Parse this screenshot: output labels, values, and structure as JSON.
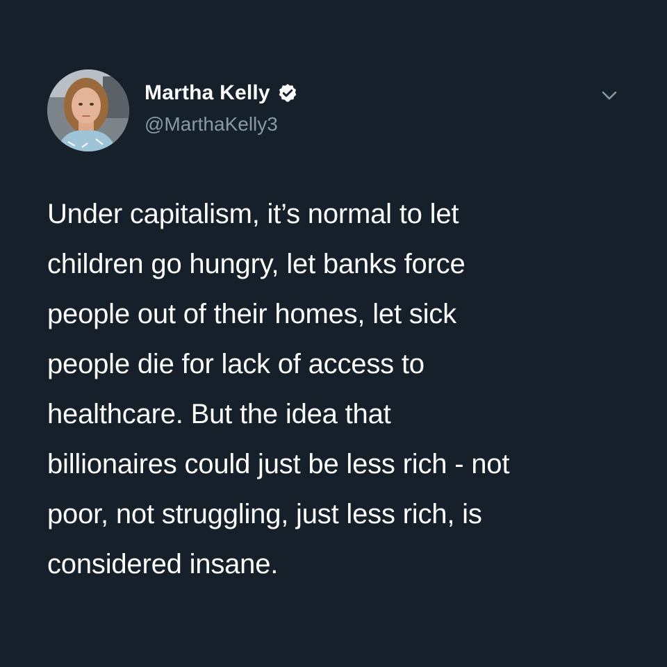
{
  "tweet": {
    "author": {
      "display_name": "Martha Kelly",
      "handle": "@MarthaKelly3",
      "verified": true,
      "avatar_icon": "profile-photo"
    },
    "menu_icon": "chevron-down-icon",
    "text_lines": [
      "Under capitalism, it’s normal to let",
      "children go hungry, let banks force",
      "people out of their homes, let sick",
      "people die for lack of access to",
      "healthcare. But the idea that",
      "billionaires could just be less rich - not",
      "poor, not struggling, just less rich, is",
      "considered insane."
    ]
  },
  "colors": {
    "background": "#15202b",
    "text": "#ffffff",
    "secondary_text": "#8899a6",
    "verified_badge": "#ffffff"
  }
}
